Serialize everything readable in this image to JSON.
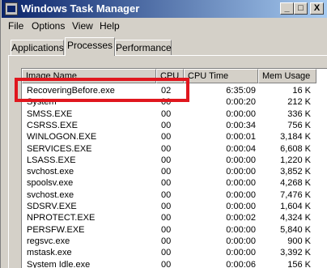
{
  "window": {
    "title": "Windows Task Manager",
    "min": "_",
    "max": "□",
    "close": "X"
  },
  "menu": [
    "File",
    "Options",
    "View",
    "Help"
  ],
  "tabs": [
    "Applications",
    "Processes",
    "Performance"
  ],
  "columns": {
    "name": "Image Name",
    "cpu": "CPU",
    "time": "CPU Time",
    "mem": "Mem Usage"
  },
  "processes": [
    {
      "name": "RecoveringBefore.exe",
      "cpu": "02",
      "time": "6:35:09",
      "mem": "16 K"
    },
    {
      "name": "System",
      "cpu": "00",
      "time": "0:00:20",
      "mem": "212 K"
    },
    {
      "name": "SMSS.EXE",
      "cpu": "00",
      "time": "0:00:00",
      "mem": "336 K"
    },
    {
      "name": "CSRSS.EXE",
      "cpu": "00",
      "time": "0:00:34",
      "mem": "756 K"
    },
    {
      "name": "WINLOGON.EXE",
      "cpu": "00",
      "time": "0:00:01",
      "mem": "3,184 K"
    },
    {
      "name": "SERVICES.EXE",
      "cpu": "00",
      "time": "0:00:04",
      "mem": "6,608 K"
    },
    {
      "name": "LSASS.EXE",
      "cpu": "00",
      "time": "0:00:00",
      "mem": "1,220 K"
    },
    {
      "name": "svchost.exe",
      "cpu": "00",
      "time": "0:00:00",
      "mem": "3,852 K"
    },
    {
      "name": "spoolsv.exe",
      "cpu": "00",
      "time": "0:00:00",
      "mem": "4,268 K"
    },
    {
      "name": "svchost.exe",
      "cpu": "00",
      "time": "0:00:00",
      "mem": "7,476 K"
    },
    {
      "name": "SDSRV.EXE",
      "cpu": "00",
      "time": "0:00:00",
      "mem": "1,604 K"
    },
    {
      "name": "NPROTECT.EXE",
      "cpu": "00",
      "time": "0:00:02",
      "mem": "4,324 K"
    },
    {
      "name": "PERSFW.EXE",
      "cpu": "00",
      "time": "0:00:00",
      "mem": "5,840 K"
    },
    {
      "name": "regsvc.exe",
      "cpu": "00",
      "time": "0:00:00",
      "mem": "900 K"
    },
    {
      "name": "mstask.exe",
      "cpu": "00",
      "time": "0:00:00",
      "mem": "3,392 K"
    },
    {
      "name": "System Idle.exe",
      "cpu": "00",
      "time": "0:00:06",
      "mem": "156 K"
    }
  ],
  "colors": {
    "titlebar_start": "#0a246a",
    "titlebar_end": "#a6caf0",
    "highlight": "#e0171e"
  }
}
